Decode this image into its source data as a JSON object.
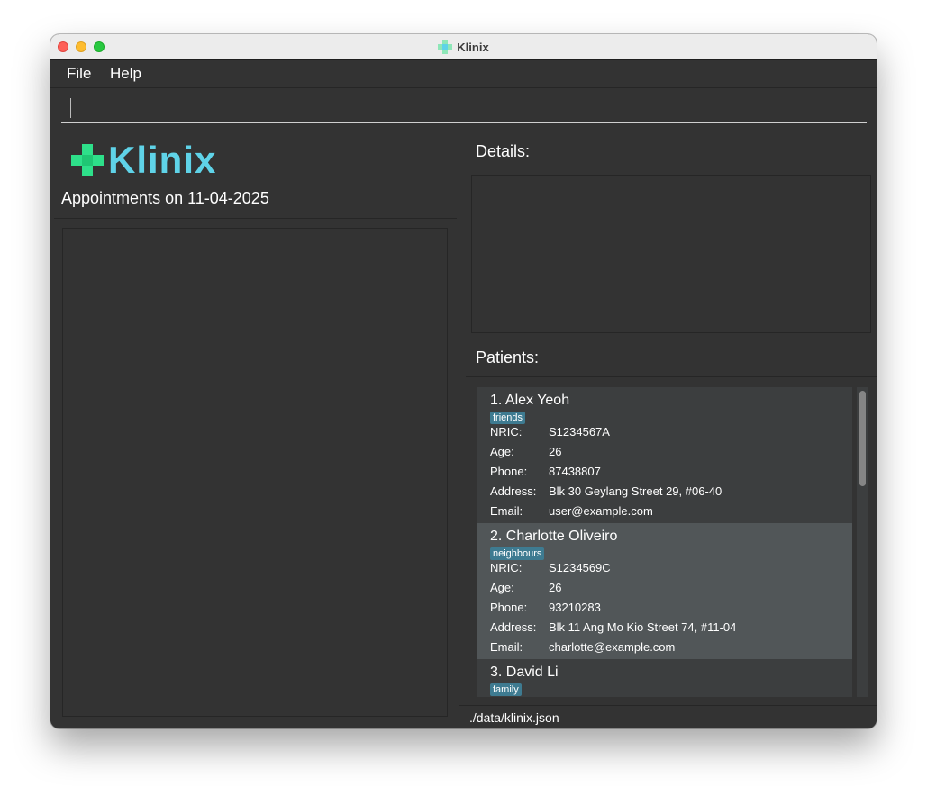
{
  "window": {
    "title": "Klinix",
    "app_icon": "plus-cross-icon"
  },
  "menu": {
    "file": "File",
    "help": "Help"
  },
  "command_box": {
    "value": ""
  },
  "left_panel": {
    "logo_text": "Klinix",
    "appointments_heading": "Appointments on 11-04-2025"
  },
  "right_panel": {
    "details_label": "Details:",
    "patients_label": "Patients:"
  },
  "field_labels": {
    "nric": "NRIC:",
    "age": "Age:",
    "phone": "Phone:",
    "address": "Address:",
    "email": "Email:"
  },
  "patients": [
    {
      "name": "1. Alex Yeoh",
      "tag": "friends",
      "nric": "S1234567A",
      "age": "26",
      "phone": "87438807",
      "address": "Blk 30 Geylang Street 29, #06-40",
      "email": "user@example.com"
    },
    {
      "name": "2. Charlotte Oliveiro",
      "tag": "neighbours",
      "nric": "S1234569C",
      "age": "26",
      "phone": "93210283",
      "address": "Blk 11 Ang Mo Kio Street 74, #11-04",
      "email": "charlotte@example.com"
    },
    {
      "name": "3. David Li",
      "tag": "family"
    }
  ],
  "status_bar": {
    "path": "./data/klinix.json"
  },
  "colors": {
    "background": "#333333",
    "card": "#3c3e3f",
    "card_selected": "#515658",
    "tag": "#3e7b91",
    "logo_cross": "#2ee08a",
    "logo_text": "#5fd3e8"
  }
}
